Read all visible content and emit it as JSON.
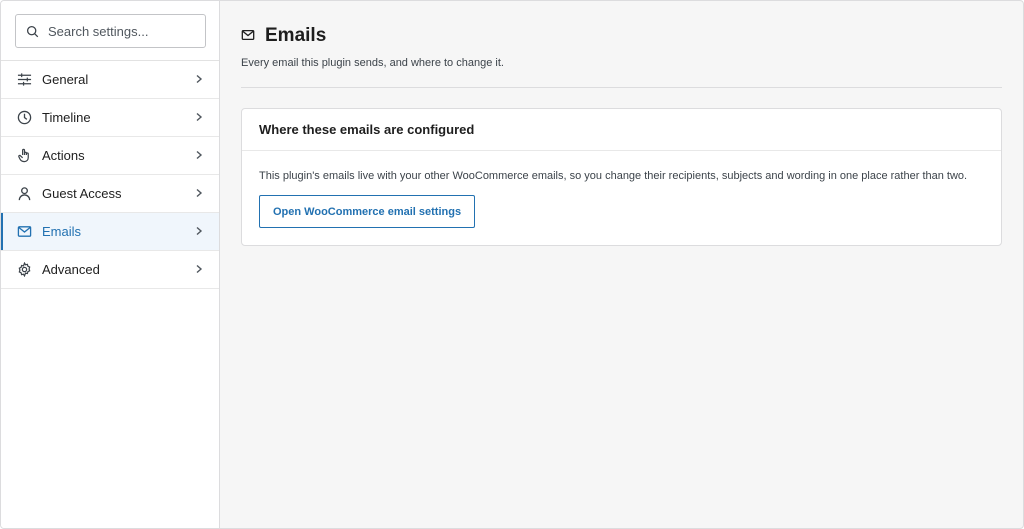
{
  "search": {
    "placeholder": "Search settings..."
  },
  "sidebar": {
    "items": [
      {
        "label": "General",
        "icon": "sliders-icon"
      },
      {
        "label": "Timeline",
        "icon": "clock-icon"
      },
      {
        "label": "Actions",
        "icon": "hand-pointer-icon"
      },
      {
        "label": "Guest Access",
        "icon": "person-icon"
      },
      {
        "label": "Emails",
        "icon": "envelope-icon",
        "active": true
      },
      {
        "label": "Advanced",
        "icon": "gear-icon"
      }
    ]
  },
  "page": {
    "title": "Emails",
    "icon": "envelope-icon",
    "subtitle": "Every email this plugin sends, and where to change it."
  },
  "card": {
    "title": "Where these emails are configured",
    "body": "This plugin's emails live with your other WooCommerce emails, so you change their recipients, subjects and wording in one place rather than two.",
    "button_label": "Open WooCommerce email settings"
  },
  "colors": {
    "accent": "#2271b1",
    "active_bg": "#f0f6fc",
    "border": "#dcdcde"
  }
}
